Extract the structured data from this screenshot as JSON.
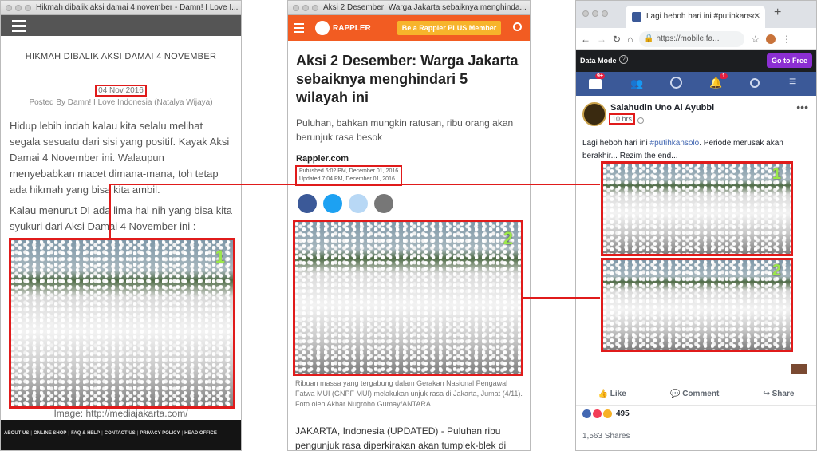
{
  "left": {
    "window_title": "Hikmah dibalik aksi damai 4 november - Damn! I Love I...",
    "post_title": "HIKMAH DIBALIK AKSI DAMAI 4 NOVEMBER",
    "date": "04 Nov 2016",
    "byline": "Posted By Damn! I Love Indonesia (Natalya Wijaya)",
    "para1": "Hidup lebih indah kalau kita selalu melihat segala sesuatu dari sisi yang positif. Kayak Aksi Damai 4 November ini. Walaupun menyebabkan macet dimana-mana, toh tetap ada hikmah yang bisa kita ambil.",
    "para2": "Kalau menurut DI ada lima hal nih yang bisa kita syukuri dari Aksi Damai 4 November ini :",
    "image_num": "1",
    "caption": "Image: http://mediajakarta.com/",
    "footer_links": [
      "ABOUT US",
      "ONLINE SHOP",
      "FAQ & HELP",
      "CONTACT US",
      "PRIVACY POLICY",
      "HEAD OFFICE"
    ]
  },
  "middle": {
    "window_title": "Aksi 2 Desember: Warga Jakarta sebaiknya menghinda...",
    "brand": "RAPPLER",
    "plus_button": "Be a Rappler PLUS Member",
    "headline": "Aksi 2 Desember: Warga Jakarta sebaiknya menghindari 5 wilayah ini",
    "subhead": "Puluhan, bahkan mungkin ratusan, ribu orang akan berunjuk rasa besok",
    "source": "Rappler.com",
    "published": "Published 6:02 PM, December 01, 2016",
    "updated": "Updated 7:04 PM, December 01, 2016",
    "image_num": "2",
    "caption": "Ribuan massa yang tergabung dalam Gerakan Nasional Pengawal Fatwa MUI (GNPF MUI) melakukan unjuk rasa di Jakarta, Jumat (4/11). Foto oleh Akbar Nugroho Gumay/ANTARA",
    "body": "JAKARTA, Indonesia (UPDATED) - Puluhan ribu pengunjuk rasa diperkirakan akan tumplek-blek di"
  },
  "right": {
    "tab_title": "Lagi heboh hari ini #putihkanso",
    "url": "https://mobile.fa...",
    "data_mode": "Data Mode",
    "go_free": "Go to Free",
    "friend_badge": "9+",
    "notif_badge": "1",
    "author": "Salahudin Uno Al Ayubbi",
    "time": "10 hrs",
    "post_text_a": "Lagi heboh hari ini ",
    "post_hashtag": "#putihkansolo",
    "post_text_b": ". Periode merusak akan berakhir... Rezim the end...",
    "image1_num": "1",
    "image2_num": "2",
    "like": "Like",
    "comment": "Comment",
    "share": "Share",
    "reactions_count": "495",
    "shares": "1,563 Shares"
  }
}
